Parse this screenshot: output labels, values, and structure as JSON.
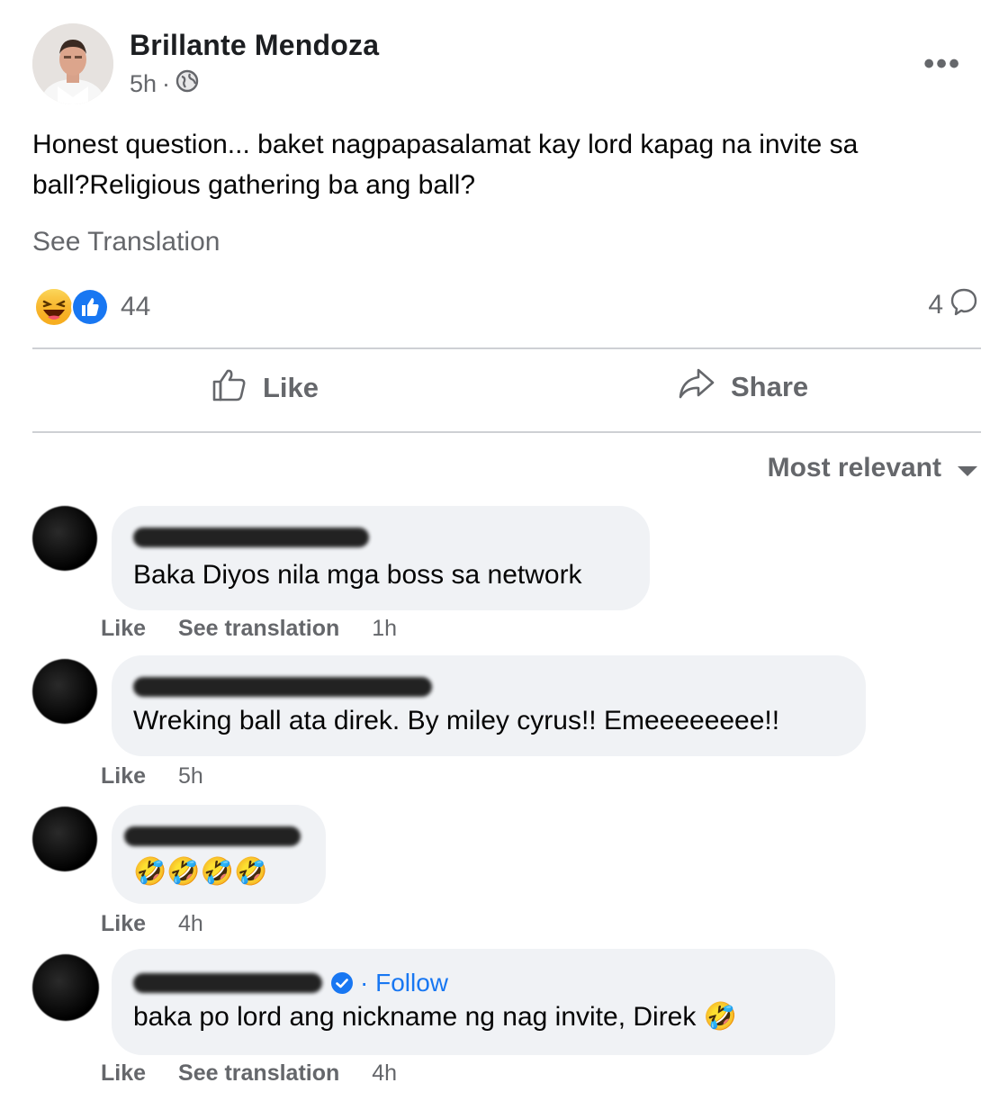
{
  "post": {
    "author": "Brillante Mendoza",
    "time": "5h",
    "privacy_icon": "globe-icon",
    "more_icon": "more-dots-icon",
    "text_line1": "Honest question... baket nagpapasalamat kay lord kapag na invite sa",
    "text_line2": "ball?Religious gathering ba ang ball?",
    "see_translation": "See Translation",
    "reaction_icons": [
      "haha-icon",
      "like-icon"
    ],
    "reaction_count": "44",
    "comment_count": "4"
  },
  "actions": {
    "like_label": "Like",
    "share_label": "Share"
  },
  "sort": {
    "selected": "Most relevant"
  },
  "comments": [
    {
      "text": "Baka Diyos nila mga boss sa network",
      "actions": [
        "Like",
        "See translation"
      ],
      "time": "1h"
    },
    {
      "text": "Wreking ball ata direk. By miley cyrus!! Emeeeeeeee!!",
      "actions": [
        "Like"
      ],
      "time": "5h"
    },
    {
      "text": "🤣🤣🤣🤣",
      "actions": [
        "Like"
      ],
      "time": "4h"
    },
    {
      "follow": "· Follow",
      "text": "baka po lord ang nickname ng nag invite, Direk 🤣",
      "actions": [
        "Like",
        "See translation"
      ],
      "time": "4h"
    }
  ],
  "colors": {
    "text_primary": "#050505",
    "text_secondary": "#65676b",
    "bubble_bg": "#f0f2f5",
    "accent_blue": "#1877f2",
    "divider": "#ced0d4"
  }
}
